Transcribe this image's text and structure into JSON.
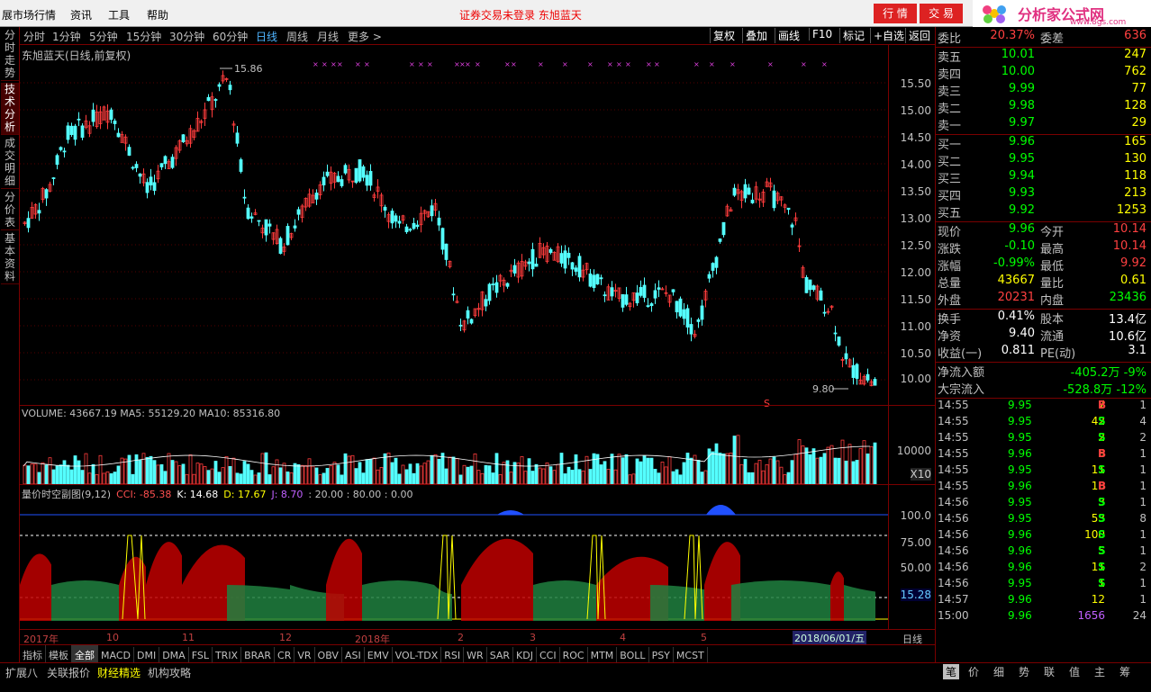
{
  "menubar": {
    "items": [
      "展市场行情",
      "资讯",
      "工具",
      "帮助"
    ],
    "warning": "证券交易未登录  东旭蓝天",
    "btn_hq": "行 情",
    "btn_jy": "交 易",
    "logo_text": "分析家公式网",
    "logo_url": "www.8gs.com"
  },
  "left_tabs": [
    "分时走势",
    "技术分析",
    "成交明细",
    "分价表",
    "基本资料"
  ],
  "toolbar": {
    "periods": [
      "分时",
      "1分钟",
      "5分钟",
      "15分钟",
      "30分钟",
      "60分钟",
      "日线",
      "周线",
      "月线",
      "更多 >"
    ],
    "selected": "日线",
    "right": [
      "复权",
      "叠加",
      "画线",
      "F10",
      "标记",
      "+自选",
      "返回"
    ]
  },
  "price": {
    "title": "东旭蓝天(日线,前复权)",
    "hi_label": "15.86",
    "lo_label": "9.80",
    "ticks": [
      "15.50",
      "15.00",
      "14.50",
      "14.00",
      "13.50",
      "13.00",
      "12.50",
      "12.00",
      "11.50",
      "11.00",
      "10.50",
      "10.00"
    ]
  },
  "volume": {
    "title": "VOLUME: 43667.19  MA5: 55129.20  MA10: 85316.80",
    "tick": "10000",
    "x10": "X10"
  },
  "indicator": {
    "name": "量价时空副图(9,12)",
    "cci": "CCI: -85.38",
    "k": "K: 14.68",
    "d": "D: 17.67",
    "j": "J: 8.70",
    "lv": ": 20.00  : 80.00  : 0.00",
    "ticks": [
      "100.0",
      "75.00",
      "50.00"
    ],
    "cur": "15.28"
  },
  "dates": {
    "labels": [
      "2017年",
      "10",
      "11",
      "12",
      "2018年",
      "2",
      "3",
      "4",
      "5"
    ],
    "current": "2018/06/01/五",
    "period": "日线"
  },
  "tabbar": [
    "指标",
    "模板",
    "全部",
    "MACD",
    "DMI",
    "DMA",
    "FSL",
    "TRIX",
    "BRAR",
    "CR",
    "VR",
    "OBV",
    "ASI",
    "EMV",
    "VOL-TDX",
    "RSI",
    "WR",
    "SAR",
    "KDJ",
    "CCI",
    "ROC",
    "MTM",
    "BOLL",
    "PSY",
    "MCST"
  ],
  "bottombar": [
    "扩展八",
    "关联报价",
    "财经精选",
    "机构攻略"
  ],
  "quote": {
    "weibi": {
      "l": "委比",
      "v": "20.37%",
      "l2": "委差",
      "v2": "636"
    },
    "sell": [
      {
        "l": "卖五",
        "p": "10.01",
        "v": "247"
      },
      {
        "l": "卖四",
        "p": "10.00",
        "v": "762"
      },
      {
        "l": "卖三",
        "p": "9.99",
        "v": "77"
      },
      {
        "l": "卖二",
        "p": "9.98",
        "v": "128"
      },
      {
        "l": "卖一",
        "p": "9.97",
        "v": "29"
      }
    ],
    "buy": [
      {
        "l": "买一",
        "p": "9.96",
        "v": "165"
      },
      {
        "l": "买二",
        "p": "9.95",
        "v": "130"
      },
      {
        "l": "买三",
        "p": "9.94",
        "v": "118"
      },
      {
        "l": "买四",
        "p": "9.93",
        "v": "213"
      },
      {
        "l": "买五",
        "p": "9.92",
        "v": "1253"
      }
    ],
    "stats": [
      {
        "l": "现价",
        "v": "9.96",
        "l2": "今开",
        "v2": "10.14"
      },
      {
        "l": "涨跌",
        "v": "-0.10",
        "l2": "最高",
        "v2": "10.14"
      },
      {
        "l": "涨幅",
        "v": "-0.99%",
        "l2": "最低",
        "v2": "9.92"
      },
      {
        "l": "总量",
        "v": "43667",
        "l2": "量比",
        "v2": "0.61"
      },
      {
        "l": "外盘",
        "v": "20231",
        "l2": "内盘",
        "v2": "23436"
      }
    ],
    "stats2": [
      {
        "l": "换手",
        "v": "0.41%",
        "l2": "股本",
        "v2": "13.4亿"
      },
      {
        "l": "净资",
        "v": "9.40",
        "l2": "流通",
        "v2": "10.6亿"
      },
      {
        "l": "收益(一)",
        "v": "0.811",
        "l2": "PE(动)",
        "v2": "3.1"
      }
    ],
    "flow": [
      {
        "l": "净流入额",
        "v": "-405.2万",
        "p": "-9%"
      },
      {
        "l": "大宗流入",
        "v": "-528.8万",
        "p": "-12%"
      }
    ],
    "ticks": [
      {
        "t": "14:55",
        "p": "9.95",
        "v": "7",
        "bs": "B",
        "n": "1"
      },
      {
        "t": "14:55",
        "p": "9.95",
        "v": "42",
        "bs": "S",
        "n": "4"
      },
      {
        "t": "14:55",
        "p": "9.95",
        "v": "2",
        "bs": "S",
        "n": "2"
      },
      {
        "t": "14:55",
        "p": "9.96",
        "v": "5",
        "bs": "B",
        "n": "1"
      },
      {
        "t": "14:55",
        "p": "9.95",
        "v": "11",
        "bs": "S",
        "n": "1"
      },
      {
        "t": "14:55",
        "p": "9.96",
        "v": "10",
        "bs": "B",
        "n": "1"
      },
      {
        "t": "14:56",
        "p": "9.95",
        "v": "3",
        "bs": "S",
        "n": "1"
      },
      {
        "t": "14:56",
        "p": "9.95",
        "v": "53",
        "bs": "S",
        "n": "8"
      },
      {
        "t": "14:56",
        "p": "9.96",
        "v": "100",
        "bs": "S",
        "n": "1"
      },
      {
        "t": "14:56",
        "p": "9.96",
        "v": "5",
        "bs": "S",
        "n": "1"
      },
      {
        "t": "14:56",
        "p": "9.96",
        "v": "11",
        "bs": "S",
        "n": "2"
      },
      {
        "t": "14:56",
        "p": "9.95",
        "v": "1",
        "bs": "S",
        "n": "1"
      },
      {
        "t": "14:57",
        "p": "9.96",
        "v": "12",
        "bs": "",
        "n": "1"
      },
      {
        "t": "15:00",
        "p": "9.96",
        "v": "1656",
        "bs": "",
        "n": "24"
      }
    ],
    "tabs": [
      "笔",
      "价",
      "细",
      "势",
      "联",
      "值",
      "主",
      "筹"
    ]
  },
  "colors": {
    "up": "#ff3c3c",
    "down": "#54ffff",
    "ma": "#ffffff"
  }
}
